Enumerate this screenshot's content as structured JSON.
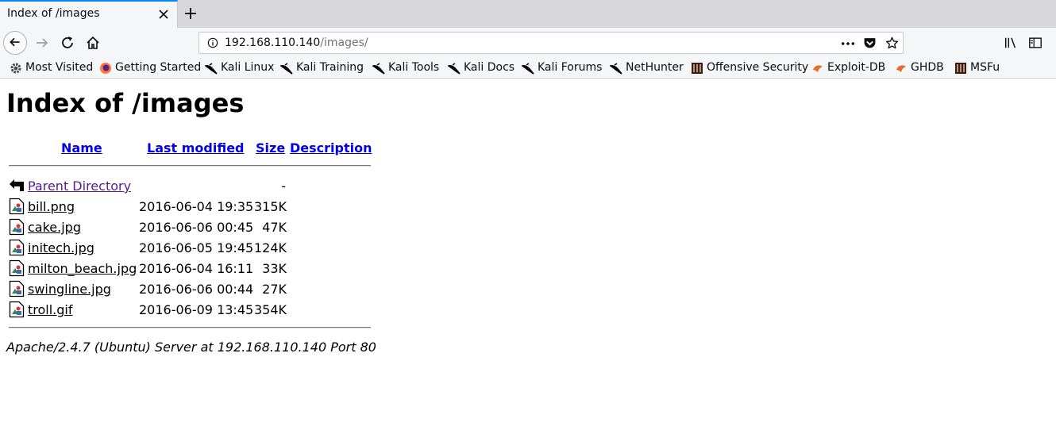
{
  "browser": {
    "tab_title": "Index of /images",
    "url_host": "192.168.110.140",
    "url_path": "/images/"
  },
  "bookmarks": [
    {
      "label": "Most Visited",
      "icon": "gear-icon"
    },
    {
      "label": "Getting Started",
      "icon": "firefox-icon"
    },
    {
      "label": "Kali Linux",
      "icon": "kali-dragon-icon"
    },
    {
      "label": "Kali Training",
      "icon": "kali-dragon-icon"
    },
    {
      "label": "Kali Tools",
      "icon": "kali-dragon-icon"
    },
    {
      "label": "Kali Docs",
      "icon": "kali-dragon-icon"
    },
    {
      "label": "Kali Forums",
      "icon": "kali-dragon-icon"
    },
    {
      "label": "NetHunter",
      "icon": "kali-dragon-icon"
    },
    {
      "label": "Offensive Security",
      "icon": "offsec-icon"
    },
    {
      "label": "Exploit-DB",
      "icon": "exploitdb-icon"
    },
    {
      "label": "GHDB",
      "icon": "exploitdb-icon"
    },
    {
      "label": "MSFu",
      "icon": "offsec-icon"
    }
  ],
  "page": {
    "heading": "Index of /images",
    "columns": {
      "name": "Name",
      "last_modified": "Last modified",
      "size": "Size",
      "description": "Description"
    },
    "parent": {
      "name": "Parent Directory",
      "size": "-"
    },
    "files": [
      {
        "name": "bill.png",
        "modified": "2016-06-04 19:35",
        "size": "315K"
      },
      {
        "name": "cake.jpg",
        "modified": "2016-06-06 00:45",
        "size": "47K"
      },
      {
        "name": "initech.jpg",
        "modified": "2016-06-05 19:45",
        "size": "124K"
      },
      {
        "name": "milton_beach.jpg",
        "modified": "2016-06-04 16:11",
        "size": "33K"
      },
      {
        "name": "swingline.jpg",
        "modified": "2016-06-06 00:44",
        "size": "27K"
      },
      {
        "name": "troll.gif",
        "modified": "2016-06-09 13:45",
        "size": "354K"
      }
    ],
    "footer": "Apache/2.4.7 (Ubuntu) Server at 192.168.110.140 Port 80"
  }
}
